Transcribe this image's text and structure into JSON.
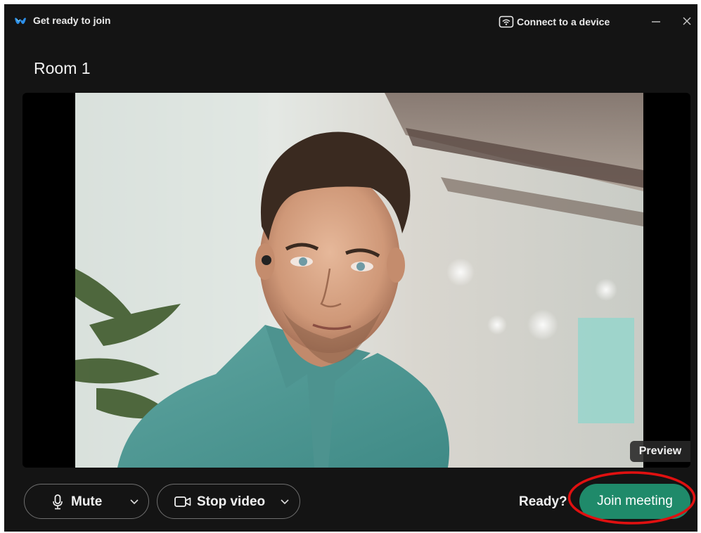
{
  "window": {
    "title": "Get ready to join",
    "connect_label": "Connect to a device",
    "minimize_label": "–",
    "close_label": "×"
  },
  "meeting": {
    "room_name": "Room 1"
  },
  "preview": {
    "badge": "Preview"
  },
  "controls": {
    "mute_label": "Mute",
    "video_label": "Stop video",
    "ready_text": "Ready?",
    "join_label": "Join meeting"
  },
  "colors": {
    "background": "#141414",
    "join_button": "#1f8a6a",
    "highlight_ring": "#e01010",
    "logo_blue": "#2d8fe8"
  },
  "icons": [
    "webex-logo-icon",
    "cast-device-icon",
    "minimize-icon",
    "close-icon",
    "microphone-icon",
    "chevron-down-icon",
    "video-camera-icon"
  ]
}
